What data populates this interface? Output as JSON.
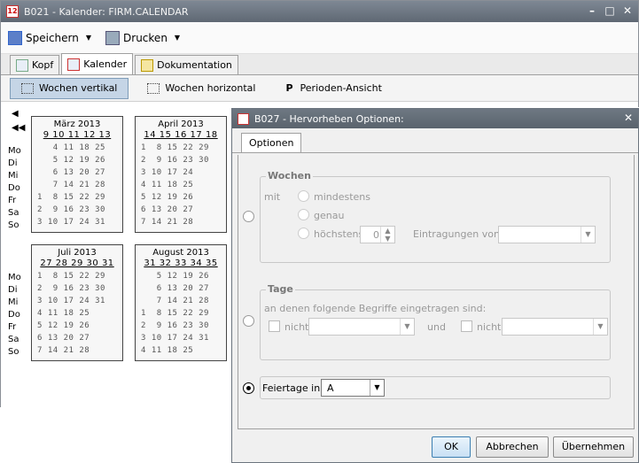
{
  "window": {
    "title": "B021 - Kalender: FIRM.CALENDAR",
    "controls": [
      "–",
      "□",
      "✕"
    ]
  },
  "toolbar": {
    "save_label": "Speichern",
    "print_label": "Drucken"
  },
  "tabs": [
    "Kopf",
    "Kalender",
    "Dokumentation"
  ],
  "views": [
    "Wochen vertikal",
    "Wochen horizontal",
    "Perioden-Ansicht"
  ],
  "perioden_prefix": "P",
  "days": [
    "Mo",
    "Di",
    "Mi",
    "Do",
    "Fr",
    "Sa",
    "So"
  ],
  "months": [
    {
      "name": "März 2013",
      "weeks": "9 10 11 12 13",
      "rows": [
        "   4 11 18 25",
        "   5 12 19 26",
        "   6 13 20 27",
        "   7 14 21 28",
        "1  8 15 22 29",
        "2  9 16 23 30",
        "3 10 17 24 31"
      ]
    },
    {
      "name": "April 2013",
      "weeks": "14 15 16 17 18",
      "rows": [
        "1  8 15 22 29",
        "2  9 16 23 30",
        "3 10 17 24",
        "4 11 18 25",
        "5 12 19 26",
        "6 13 20 27",
        "7 14 21 28"
      ]
    },
    {
      "name": "Juli 2013",
      "weeks": "27 28 29 30 31",
      "rows": [
        "1  8 15 22 29",
        "2  9 16 23 30",
        "3 10 17 24 31",
        "4 11 18 25",
        "5 12 19 26",
        "6 13 20 27",
        "7 14 21 28"
      ]
    },
    {
      "name": "August 2013",
      "weeks": "31 32 33 34 35",
      "rows": [
        "   5 12 19 26",
        "   6 13 20 27",
        "   7 14 21 28",
        "1  8 15 22 29",
        "2  9 16 23 30",
        "3 10 17 24 31",
        "4 11 18 25"
      ]
    }
  ],
  "dialog": {
    "title": "B027 - Hervorheben Optionen:",
    "tab": "Optionen",
    "wochen": {
      "label": "Wochen",
      "mit": "mit",
      "mindestens": "mindestens",
      "genau": "genau",
      "hoechstens": "höchstens",
      "spinner_value": "0",
      "eintragungen": "Eintragungen von:"
    },
    "tage": {
      "label": "Tage",
      "desc": "an denen folgende Begriffe eingetragen sind:",
      "nicht1": "nicht",
      "und": "und",
      "nicht2": "nicht"
    },
    "feiertage": {
      "label": "Feiertage in:",
      "value": "A"
    },
    "buttons": {
      "ok": "OK",
      "cancel": "Abbrechen",
      "apply": "Übernehmen"
    }
  }
}
